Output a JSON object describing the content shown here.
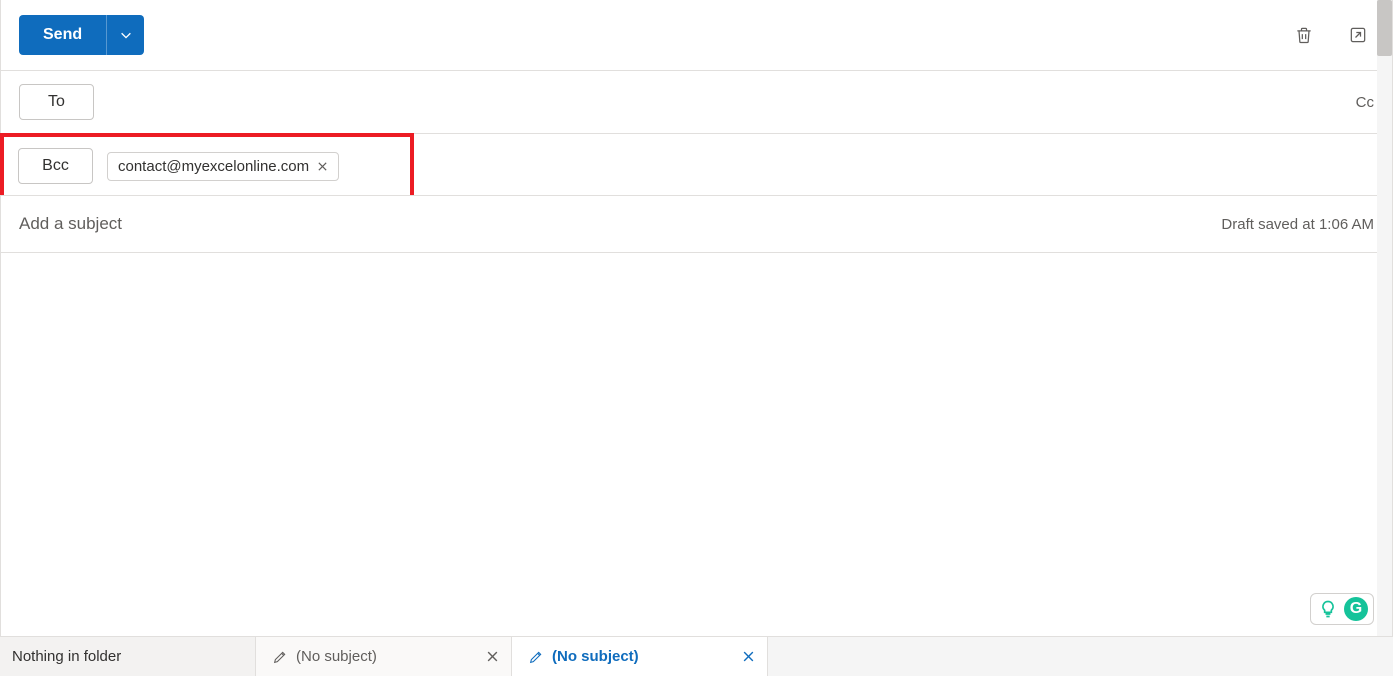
{
  "toolbar": {
    "send_label": "Send"
  },
  "recipients": {
    "to_label": "To",
    "cc_label": "Cc",
    "bcc_label": "Bcc",
    "bcc_chip": "contact@myexcelonline.com"
  },
  "subject": {
    "placeholder": "Add a subject",
    "draft_status": "Draft saved at 1:06 AM"
  },
  "tabs": {
    "folder_status": "Nothing in folder",
    "draft1": "(No subject)",
    "draft2": "(No subject)"
  }
}
